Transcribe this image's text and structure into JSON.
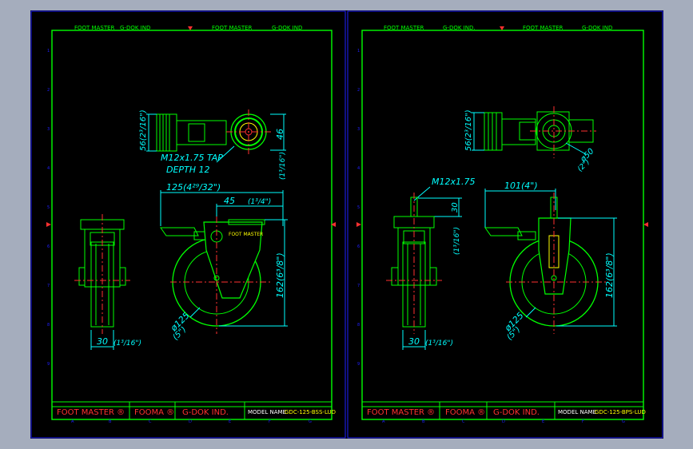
{
  "header_text": {
    "foot_master": "FOOT MASTER",
    "gdok_ind": "G-DOK IND",
    "gdok_ind_dot": "G-DOK IND."
  },
  "left_sheet": {
    "dims": {
      "d56": "56(2³/16\")",
      "d46": "46",
      "d13": "(1³/16\")",
      "tap": "M12x1.75  TAP",
      "depth": "DEPTH  12",
      "d125": "125(4²⁹/32\")",
      "d45": "45",
      "d13_4": "(1³/4\")",
      "d30": "30",
      "d30_in": "(1³/16\")",
      "d162": "162(6³/8\")",
      "dia125": "ø125",
      "dia5": "(5\")"
    },
    "body_label": "FOOT MASTER",
    "title_block": {
      "c1": "FOOT MASTER  ®",
      "c2": "FOOMA ®",
      "c3": "G-DOK IND.",
      "model": "MODEL  NAME",
      "model_name": "GDC-125-BSS-LUD"
    }
  },
  "right_sheet": {
    "dims": {
      "d56": "56(2³/16\")",
      "dia50": "ø50",
      "dia50_in": "(2\")",
      "thread": "M12x1.75",
      "d101": "101(4\")",
      "d30v": "30",
      "d30v_in": "(1³/16\")",
      "d30": "30",
      "d30_in": "(1³/16\")",
      "d162": "162(6³/8\")",
      "dia125": "ø125",
      "dia5": "(5\")"
    },
    "title_block": {
      "c1": "FOOT MASTER  ®",
      "c2": "FOOMA ®",
      "c3": "G-DOK IND.",
      "model": "MODEL  NAME",
      "model_name": "GDC-125-BPS-LUD"
    }
  },
  "zone_rows": [
    "1",
    "2",
    "3",
    "4",
    "5",
    "6",
    "7",
    "8",
    "9"
  ],
  "zone_cols": [
    "A",
    "B",
    "C",
    "D",
    "E",
    "F",
    "G"
  ],
  "colors": {
    "background": "#000000",
    "frame": "#00ff00",
    "dimension": "#00ffff",
    "centerline": "#ff0000",
    "border_blue": "#2020ff",
    "title_red": "#ff3030",
    "label_yellow": "#ffff00",
    "screen_bg": "#a5adbd"
  }
}
